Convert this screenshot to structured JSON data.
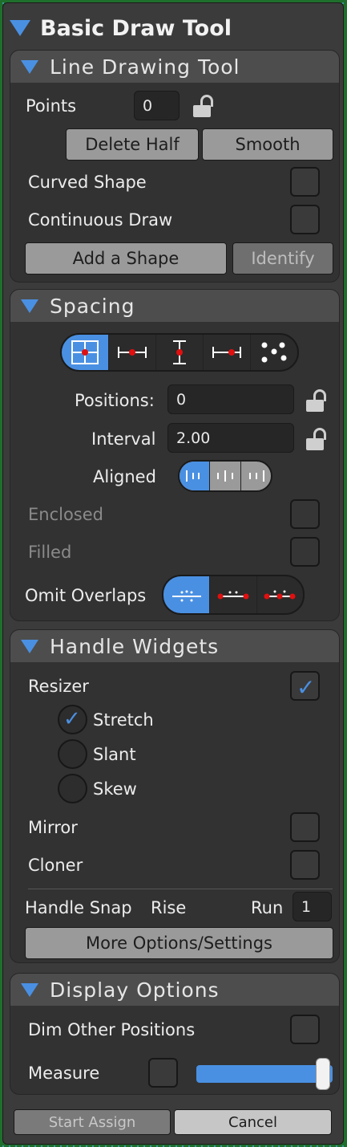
{
  "window": {
    "title": "Basic Draw Tool"
  },
  "line_tool": {
    "title": "Line Drawing Tool",
    "points_label": "Points",
    "points_value": "0",
    "delete_half": "Delete Half",
    "smooth": "Smooth",
    "curved_shape": "Curved Shape",
    "continuous_draw": "Continuous Draw",
    "add_shape": "Add a Shape",
    "identify": "Identify"
  },
  "spacing": {
    "title": "Spacing",
    "positions_label": "Positions:",
    "positions_value": "0",
    "interval_label": "Interval",
    "interval_value": "2.00",
    "aligned_label": "Aligned",
    "enclosed_label": "Enclosed",
    "filled_label": "Filled",
    "omit_overlaps_label": "Omit Overlaps"
  },
  "handles": {
    "title": "Handle Widgets",
    "resizer": "Resizer",
    "stretch": "Stretch",
    "slant": "Slant",
    "skew": "Skew",
    "mirror": "Mirror",
    "cloner": "Cloner",
    "handle_snap": "Handle Snap",
    "rise": "Rise",
    "run": "Run",
    "run_value": "1",
    "more_options": "More Options/Settings"
  },
  "display": {
    "title": "Display Options",
    "dim_other": "Dim Other Positions",
    "measure": "Measure",
    "measure_level": 0.93
  },
  "footer": {
    "start_assign": "Start Assign",
    "cancel": "Cancel"
  },
  "colors": {
    "accent": "#4a90e2",
    "panel": "#3b3b3b"
  }
}
